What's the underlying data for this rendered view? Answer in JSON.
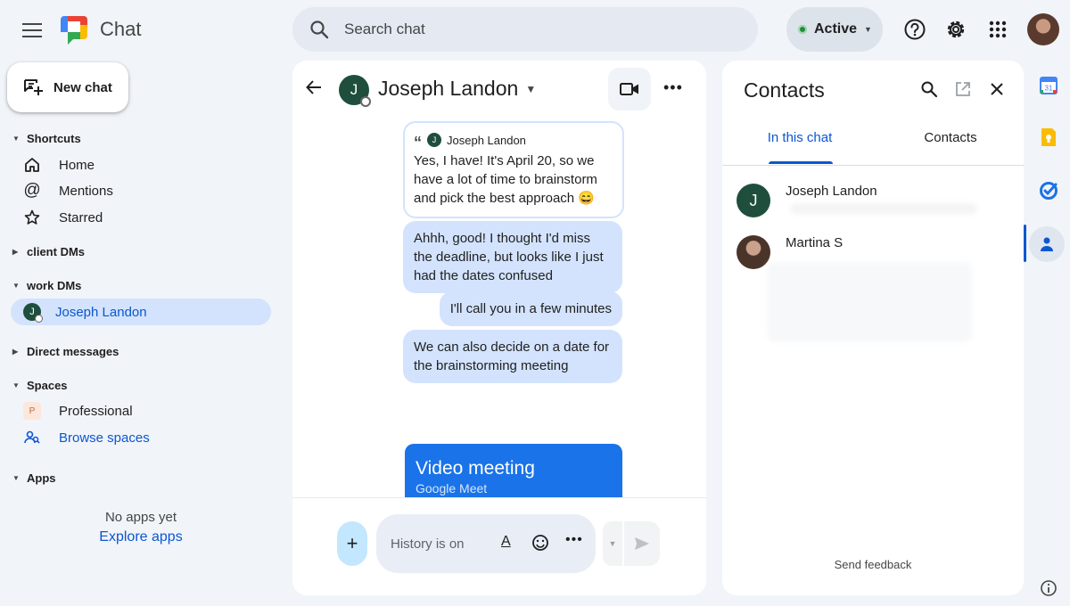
{
  "app": {
    "title": "Chat"
  },
  "search": {
    "placeholder": "Search chat"
  },
  "status": {
    "label": "Active",
    "color": "#1e8e3e"
  },
  "header_icons": [
    "hamburger-menu-icon",
    "help-icon",
    "gear-icon",
    "apps-grid-icon",
    "account-avatar"
  ],
  "sidebar": {
    "new_chat_label": "New chat",
    "shortcuts": {
      "label": "Shortcuts",
      "items": [
        {
          "label": "Home",
          "icon": "home-icon"
        },
        {
          "label": "Mentions",
          "icon": "at-icon"
        },
        {
          "label": "Starred",
          "icon": "star-icon"
        }
      ]
    },
    "client_dms": {
      "label": "client DMs"
    },
    "work_dms": {
      "label": "work DMs",
      "items": [
        {
          "label": "Joseph Landon",
          "initial": "J",
          "selected": true
        }
      ]
    },
    "direct_messages": {
      "label": "Direct messages"
    },
    "spaces": {
      "label": "Spaces",
      "items": [
        {
          "label": "Professional",
          "badge": "P"
        }
      ],
      "browse_label": "Browse spaces"
    },
    "apps": {
      "label": "Apps",
      "empty_text": "No apps yet",
      "explore_label": "Explore apps"
    }
  },
  "conversation": {
    "name": "Joseph Landon",
    "initial": "J",
    "quoted": {
      "author": "Joseph Landon",
      "author_initial": "J",
      "text": "Yes, I have! It's April 20, so we have a lot of time to brainstorm and pick the best approach 😄"
    },
    "messages": [
      {
        "text": "Ahhh, good! I thought I'd miss the deadline, but looks like I just had the dates confused"
      },
      {
        "text": "I'll call you in a few minutes"
      },
      {
        "text": "We can also decide on a date for the brainstorming meeting"
      }
    ],
    "video_card": {
      "title": "Video meeting",
      "subtitle": "Google Meet"
    },
    "composer": {
      "placeholder": "History is on"
    }
  },
  "contacts_panel": {
    "title": "Contacts",
    "tabs": [
      {
        "label": "In this chat",
        "active": true
      },
      {
        "label": "Contacts",
        "active": false
      }
    ],
    "people": [
      {
        "name": "Joseph Landon",
        "initial": "J"
      },
      {
        "name": "Martina S"
      }
    ],
    "feedback_label": "Send feedback"
  },
  "right_rail": {
    "icons": [
      "calendar-icon",
      "keep-icon",
      "tasks-icon",
      "contacts-icon",
      "info-icon"
    ],
    "calendar_day": "31"
  },
  "colors": {
    "accent": "#0b57d0",
    "selected_bg": "#d3e3fd",
    "bubble": "#d3e3fd",
    "meet_blue": "#1a73e8",
    "avatar_green": "#1f4e3d"
  }
}
